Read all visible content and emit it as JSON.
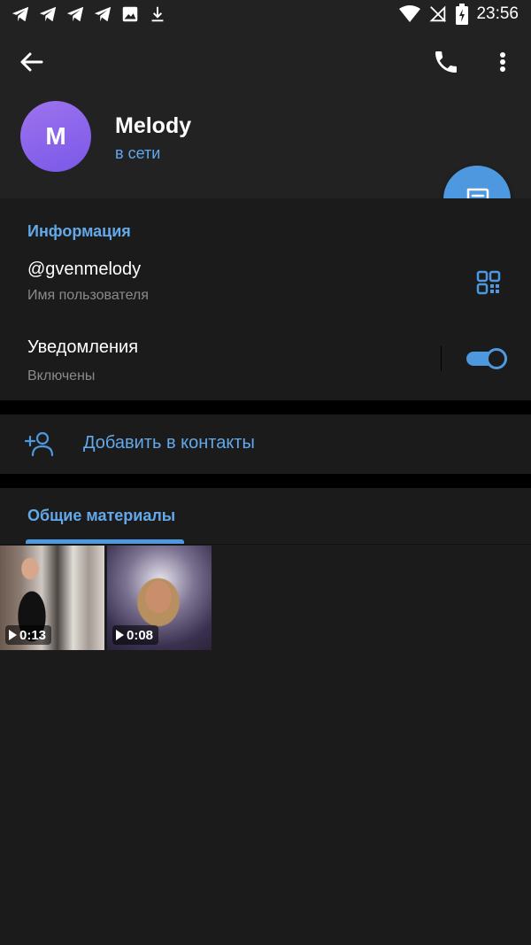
{
  "status_bar": {
    "time": "23:56",
    "left_icons": [
      "telegram-icon",
      "telegram-icon",
      "telegram-icon",
      "telegram-icon",
      "image-icon",
      "download-icon"
    ],
    "right_icons": [
      "wifi-icon",
      "no-signal-icon",
      "battery-charging-icon"
    ]
  },
  "header": {
    "avatar_letter": "M",
    "name": "Melody",
    "status": "в сети"
  },
  "info": {
    "section_title": "Информация",
    "username": "@gvenmelody",
    "username_caption": "Имя пользователя",
    "notifications_title": "Уведомления",
    "notifications_caption": "Включены",
    "notifications_enabled": true
  },
  "actions": {
    "add_contact": "Добавить в контакты"
  },
  "media": {
    "tab_label": "Общие материалы",
    "items": [
      {
        "duration": "0:13"
      },
      {
        "duration": "0:08"
      }
    ]
  },
  "colors": {
    "accent": "#4d98df",
    "accent_text": "#63a9ea",
    "background": "#1b1b1b",
    "header_bg": "#222222"
  }
}
